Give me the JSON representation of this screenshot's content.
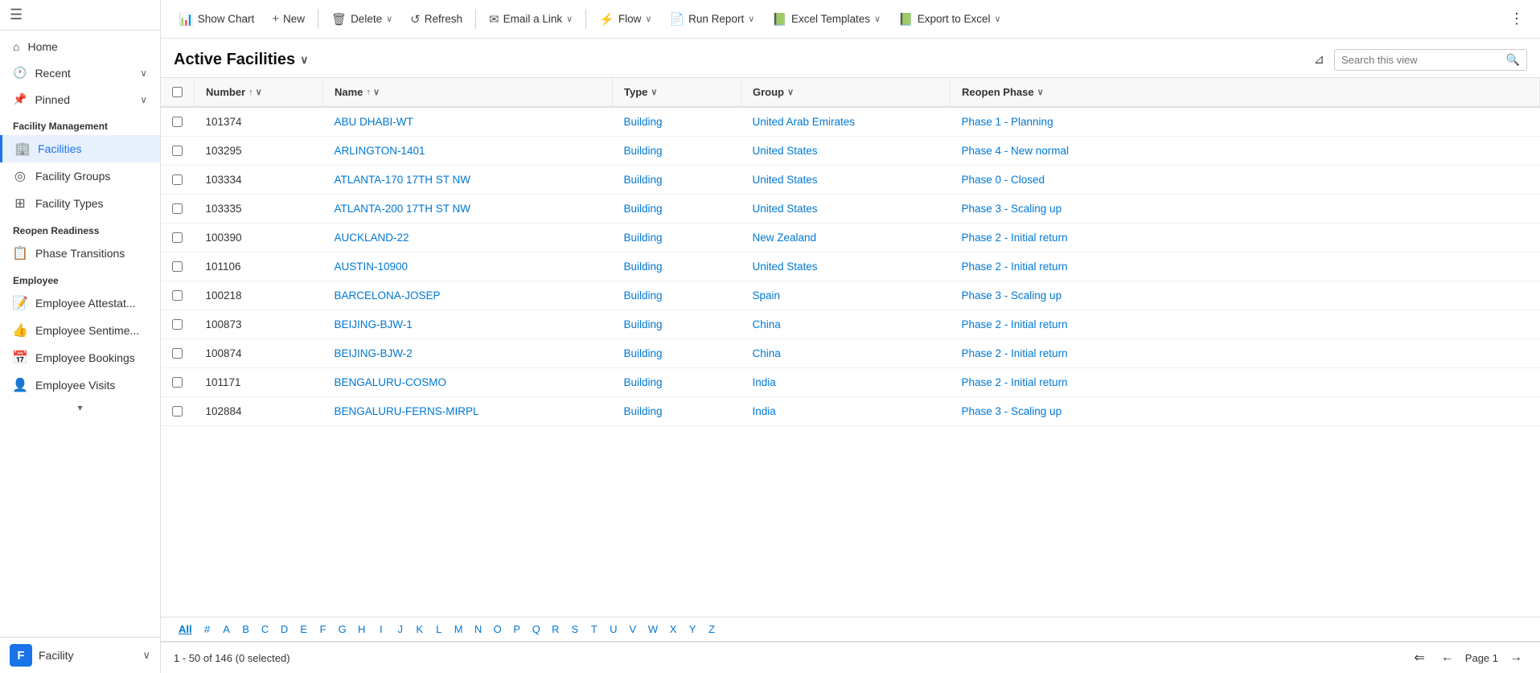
{
  "sidebar": {
    "nav_items": [
      {
        "id": "home",
        "label": "Home",
        "icon": "⌂",
        "has_chevron": false
      },
      {
        "id": "recent",
        "label": "Recent",
        "icon": "🕐",
        "has_chevron": true
      },
      {
        "id": "pinned",
        "label": "Pinned",
        "icon": "📌",
        "has_chevron": true
      }
    ],
    "sections": [
      {
        "label": "Facility Management",
        "items": [
          {
            "id": "facilities",
            "label": "Facilities",
            "icon": "🏢",
            "active": true
          },
          {
            "id": "facility-groups",
            "label": "Facility Groups",
            "icon": "◎"
          },
          {
            "id": "facility-types",
            "label": "Facility Types",
            "icon": "⊞"
          }
        ]
      },
      {
        "label": "Reopen Readiness",
        "items": [
          {
            "id": "phase-transitions",
            "label": "Phase Transitions",
            "icon": "📋"
          }
        ]
      },
      {
        "label": "Employee",
        "items": [
          {
            "id": "employee-attest",
            "label": "Employee Attestat...",
            "icon": "📝"
          },
          {
            "id": "employee-sentim",
            "label": "Employee Sentime...",
            "icon": "👍"
          },
          {
            "id": "employee-bookings",
            "label": "Employee Bookings",
            "icon": "📅"
          },
          {
            "id": "employee-visits",
            "label": "Employee Visits",
            "icon": "👤"
          }
        ]
      }
    ],
    "bottom": {
      "badge": "F",
      "label": "Facility"
    }
  },
  "toolbar": {
    "buttons": [
      {
        "id": "show-chart",
        "label": "Show Chart",
        "icon": "📊",
        "has_dropdown": false
      },
      {
        "id": "new",
        "label": "New",
        "icon": "+",
        "has_dropdown": false
      },
      {
        "id": "delete",
        "label": "Delete",
        "icon": "🗑",
        "has_dropdown": true
      },
      {
        "id": "refresh",
        "label": "Refresh",
        "icon": "↺",
        "has_dropdown": false
      },
      {
        "id": "email-link",
        "label": "Email a Link",
        "icon": "✉",
        "has_dropdown": true
      },
      {
        "id": "flow",
        "label": "Flow",
        "icon": "⚡",
        "has_dropdown": true
      },
      {
        "id": "run-report",
        "label": "Run Report",
        "icon": "📄",
        "has_dropdown": true
      },
      {
        "id": "excel-templates",
        "label": "Excel Templates",
        "icon": "📗",
        "has_dropdown": true
      },
      {
        "id": "export-excel",
        "label": "Export to Excel",
        "icon": "📗",
        "has_dropdown": true
      }
    ]
  },
  "view": {
    "title": "Active Facilities",
    "search_placeholder": "Search this view"
  },
  "columns": [
    {
      "id": "number",
      "label": "Number",
      "sort": "asc"
    },
    {
      "id": "name",
      "label": "Name",
      "sort": "asc"
    },
    {
      "id": "type",
      "label": "Type",
      "sort": null
    },
    {
      "id": "group",
      "label": "Group",
      "sort": null
    },
    {
      "id": "reopen-phase",
      "label": "Reopen Phase",
      "sort": null
    }
  ],
  "rows": [
    {
      "number": "101374",
      "name": "ABU DHABI-WT",
      "type": "Building",
      "group": "United Arab Emirates",
      "phase": "Phase 1 - Planning"
    },
    {
      "number": "103295",
      "name": "ARLINGTON-1401",
      "type": "Building",
      "group": "United States",
      "phase": "Phase 4 - New normal"
    },
    {
      "number": "103334",
      "name": "ATLANTA-170 17TH ST NW",
      "type": "Building",
      "group": "United States",
      "phase": "Phase 0 - Closed"
    },
    {
      "number": "103335",
      "name": "ATLANTA-200 17TH ST NW",
      "type": "Building",
      "group": "United States",
      "phase": "Phase 3 - Scaling up"
    },
    {
      "number": "100390",
      "name": "AUCKLAND-22",
      "type": "Building",
      "group": "New Zealand",
      "phase": "Phase 2 - Initial return"
    },
    {
      "number": "101106",
      "name": "AUSTIN-10900",
      "type": "Building",
      "group": "United States",
      "phase": "Phase 2 - Initial return"
    },
    {
      "number": "100218",
      "name": "BARCELONA-JOSEP",
      "type": "Building",
      "group": "Spain",
      "phase": "Phase 3 - Scaling up"
    },
    {
      "number": "100873",
      "name": "BEIJING-BJW-1",
      "type": "Building",
      "group": "China",
      "phase": "Phase 2 - Initial return"
    },
    {
      "number": "100874",
      "name": "BEIJING-BJW-2",
      "type": "Building",
      "group": "China",
      "phase": "Phase 2 - Initial return"
    },
    {
      "number": "101171",
      "name": "BENGALURU-COSMO",
      "type": "Building",
      "group": "India",
      "phase": "Phase 2 - Initial return"
    },
    {
      "number": "102884",
      "name": "BENGALURU-FERNS-MIRPL",
      "type": "Building",
      "group": "India",
      "phase": "Phase 3 - Scaling up"
    }
  ],
  "alphabet": [
    "All",
    "#",
    "A",
    "B",
    "C",
    "D",
    "E",
    "F",
    "G",
    "H",
    "I",
    "J",
    "K",
    "L",
    "M",
    "N",
    "O",
    "P",
    "Q",
    "R",
    "S",
    "T",
    "U",
    "V",
    "W",
    "X",
    "Y",
    "Z"
  ],
  "footer": {
    "record_info": "1 - 50 of 146 (0 selected)",
    "page_label": "Page 1"
  }
}
